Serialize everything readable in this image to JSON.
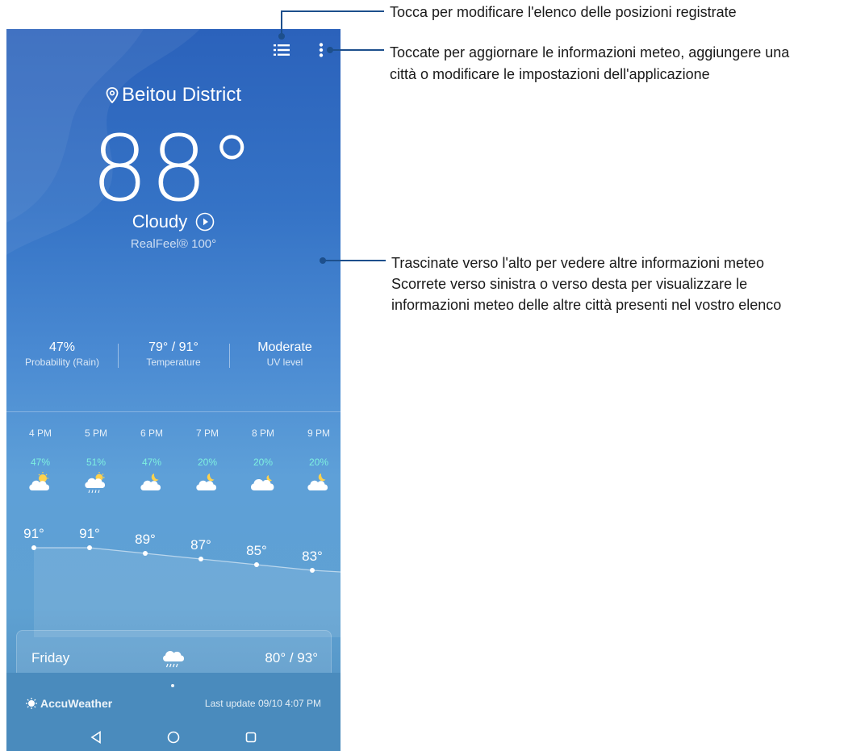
{
  "header": {
    "list_icon": "list-icon",
    "more_icon": "more-vertical-icon"
  },
  "location": {
    "name": "Beitou District",
    "icon": "location-pin-icon"
  },
  "current": {
    "temperature": "88°",
    "condition": "Cloudy",
    "realfeel": "RealFeel® 100°"
  },
  "stats": [
    {
      "value": "47%",
      "label": "Probability (Rain)"
    },
    {
      "value": "79° / 91°",
      "label": "Temperature"
    },
    {
      "value": "Moderate",
      "label": "UV level"
    }
  ],
  "hourly": [
    {
      "time": "4 PM",
      "precip": "47%",
      "icon": "partly-cloudy-day-icon",
      "temp": "91°",
      "temp_value": 91
    },
    {
      "time": "5 PM",
      "precip": "51%",
      "icon": "rain-sun-icon",
      "temp": "91°",
      "temp_value": 91
    },
    {
      "time": "6 PM",
      "precip": "47%",
      "icon": "partly-cloudy-night-icon",
      "temp": "89°",
      "temp_value": 89
    },
    {
      "time": "7 PM",
      "precip": "20%",
      "icon": "partly-cloudy-night-icon",
      "temp": "87°",
      "temp_value": 87
    },
    {
      "time": "8 PM",
      "precip": "20%",
      "icon": "cloudy-night-icon",
      "temp": "85°",
      "temp_value": 85
    },
    {
      "time": "9 PM",
      "precip": "20%",
      "icon": "partly-cloudy-night-icon",
      "temp": "83°",
      "temp_value": 83
    }
  ],
  "daily": {
    "day": "Friday",
    "icon": "rain-cloud-icon",
    "temps": "80° / 93°"
  },
  "footer": {
    "brand": "AccuWeather",
    "last_update": "Last update 09/10 4:07 PM"
  },
  "nav": [
    "back-icon",
    "home-icon",
    "recents-icon"
  ],
  "callouts": {
    "list": "Tocca per modificare l'elenco delle posizioni registrate",
    "menu_line1": "Toccate per aggiornare le informazioni meteo, aggiungere una",
    "menu_line2": "città o modificare le impostazioni dell'applicazione",
    "swipe_line1": "Trascinate verso l'alto per vedere altre informazioni meteo",
    "swipe_line2": "Scorrete verso sinistra o verso desta per visualizzare le",
    "swipe_line3": "informazioni meteo delle altre città presenti nel vostro elenco"
  },
  "colors": {
    "precip_text": "#7ef0e0",
    "callout_line": "#1d4f8c"
  }
}
